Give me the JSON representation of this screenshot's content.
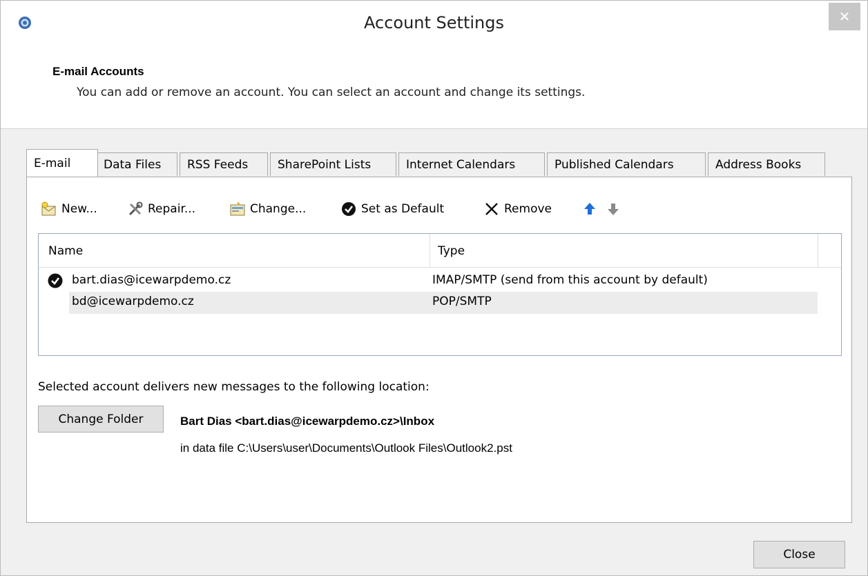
{
  "window": {
    "title": "Account Settings",
    "close_glyph": "✕"
  },
  "header": {
    "title": "E-mail Accounts",
    "subtitle": "You can add or remove an account. You can select an account and change its settings."
  },
  "tabs": [
    {
      "label": "E-mail",
      "active": true
    },
    {
      "label": "Data Files"
    },
    {
      "label": "RSS Feeds"
    },
    {
      "label": "SharePoint Lists"
    },
    {
      "label": "Internet Calendars"
    },
    {
      "label": "Published Calendars"
    },
    {
      "label": "Address Books"
    }
  ],
  "toolbar": {
    "new_label": "New...",
    "repair_label": "Repair...",
    "change_label": "Change...",
    "default_label": "Set as Default",
    "remove_label": "Remove",
    "icons": [
      "new-mail-icon",
      "repair-tools-icon",
      "change-settings-icon",
      "check-circle-icon",
      "x-icon",
      "arrow-up-icon",
      "arrow-down-icon"
    ]
  },
  "list": {
    "columns": [
      "Name",
      "Type"
    ],
    "rows": [
      {
        "name": "bart.dias@icewarpdemo.cz",
        "type": "IMAP/SMTP (send from this account by default)",
        "default": true
      },
      {
        "name": "bd@icewarpdemo.cz",
        "type": "POP/SMTP",
        "selected": true
      }
    ]
  },
  "delivery": {
    "text": "Selected account delivers new messages to the following location:",
    "change_folder_label": "Change Folder",
    "location": "Bart Dias <bart.dias@icewarpdemo.cz>\\Inbox",
    "data_file": "in data file C:\\Users\\user\\Documents\\Outlook Files\\Outlook2.pst"
  },
  "footer": {
    "close_label": "Close"
  },
  "colors": {
    "accent_blue": "#1f6fd6",
    "selection": "#ececec",
    "close_bg": "#c7c7c7"
  }
}
